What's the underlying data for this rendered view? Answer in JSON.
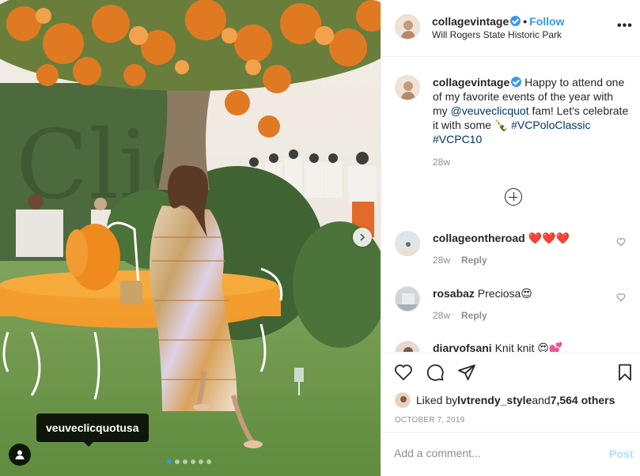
{
  "post": {
    "author": "collagevintage",
    "separator": "•",
    "follow_label": "Follow",
    "location": "Will Rogers State Historic Park",
    "more_label": "•••",
    "photo_tag": "veuveclicquotusa",
    "carousel": {
      "count": 6,
      "active_index": 0
    }
  },
  "caption": {
    "username": "collagevintage",
    "text_1": " Happy to attend one of my favorite events of the year with my ",
    "mention": "@veuveclicquot",
    "text_2": " fam! Let's celebrate it with some 🍾 ",
    "hashtag_1": "#VCPoloClassic",
    "hashtag_2": "#VCPC10",
    "time": "28w"
  },
  "comments": [
    {
      "username": "collageontheroad",
      "text": " ❤️❤️❤️",
      "time": "28w",
      "reply_label": "Reply"
    },
    {
      "username": "rosabaz",
      "text": " Preciosa😍",
      "time": "28w",
      "reply_label": "Reply"
    },
    {
      "username": "diarvofsani",
      "text": " Knit knit 😍💕"
    }
  ],
  "likes": {
    "prefix": "Liked by ",
    "user": "lvtrendy_style",
    "and": " and ",
    "count": "7,564 others"
  },
  "date": "OCTOBER 7, 2019",
  "add_comment": {
    "placeholder": "Add a comment...",
    "post_label": "Post"
  },
  "colors": {
    "accent": "#3897f0",
    "post_disabled": "#b2dffc",
    "muted": "#8e8e8e"
  }
}
